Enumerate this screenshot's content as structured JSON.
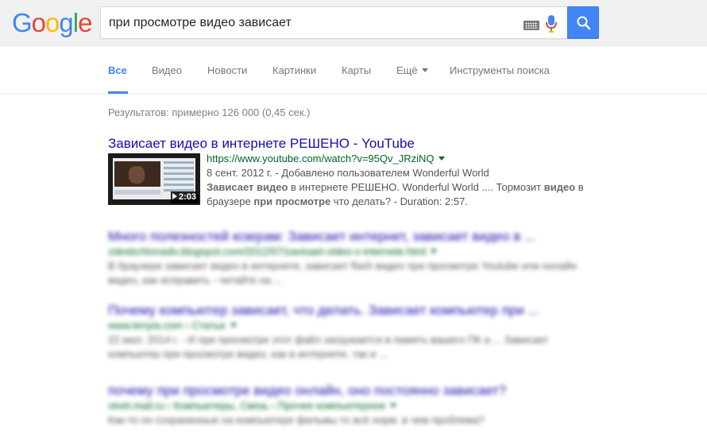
{
  "header": {
    "logo": {
      "letters": [
        "G",
        "o",
        "o",
        "g",
        "l",
        "e"
      ],
      "colors": [
        "#4285f4",
        "#ea4335",
        "#fbbc05",
        "#4285f4",
        "#34a853",
        "#ea4335"
      ]
    },
    "query": "при просмотре видео зависает",
    "icons": {
      "keyboard": "keyboard-icon",
      "mic": "microphone-icon",
      "search": "search-icon"
    },
    "accent": "#4285f4"
  },
  "tabs": [
    {
      "label": "Все",
      "active": true
    },
    {
      "label": "Видео",
      "active": false
    },
    {
      "label": "Новости",
      "active": false
    },
    {
      "label": "Картинки",
      "active": false
    },
    {
      "label": "Карты",
      "active": false
    },
    {
      "label": "Ещё",
      "active": false,
      "dropdown": true
    },
    {
      "label": "Инструменты поиска",
      "active": false
    }
  ],
  "stats": "Результатов: примерно 126 000 (0,45 сек.)",
  "results": [
    {
      "title": "Зависает видео в интернете РЕШЕНО - YouTube",
      "url": "https://www.youtube.com/watch?v=95Qv_JRziNQ",
      "meta": "8 сент. 2012 г. - Добавлено пользователем Wonderful World",
      "snippet_parts": [
        {
          "text": "Зависает видео",
          "bold": true
        },
        {
          "text": " в интернете РЕШЕНО. Wonderful World .... Тормозит ",
          "bold": false
        },
        {
          "text": "видео",
          "bold": true
        },
        {
          "text": " в браузере ",
          "bold": false
        },
        {
          "text": "при просмотре",
          "bold": true
        },
        {
          "text": " что делать? - Duration: 2:57.",
          "bold": false
        }
      ],
      "thumbnail_duration": "2:03"
    },
    {
      "title": "Много полезностей юзерам: Зависает интернет, зависает видео в ...",
      "url": "zdesbchtonado.blogspot.com/2012/07/zavisaet-video-v-internete.html",
      "snippet": "В браузере зависает видео в интернете, зависает flash видео при просмотре Youtube или онлайн видео, как исправить - читайте на ..."
    },
    {
      "title": "Почему компьютер зависает, что делать. Зависает компьютер при ...",
      "url": "www.tenyia.com › Статьи",
      "snippet": "22 июл. 2014 г. - И при просмотре этот файл загружается в память вашего ПК а ... Зависает компьютер при просмотре видео, как в интернете, так и ..."
    },
    {
      "title": "почему при просмотре видео онлайн, оно постоянно зависает?",
      "url": "otvet.mail.ru › Компьютеры, Связь › Прочее компьютерное",
      "snippet": "Как-то он сохраненные на компьютере фильмы то всё норм. в чем проблема?"
    }
  ]
}
